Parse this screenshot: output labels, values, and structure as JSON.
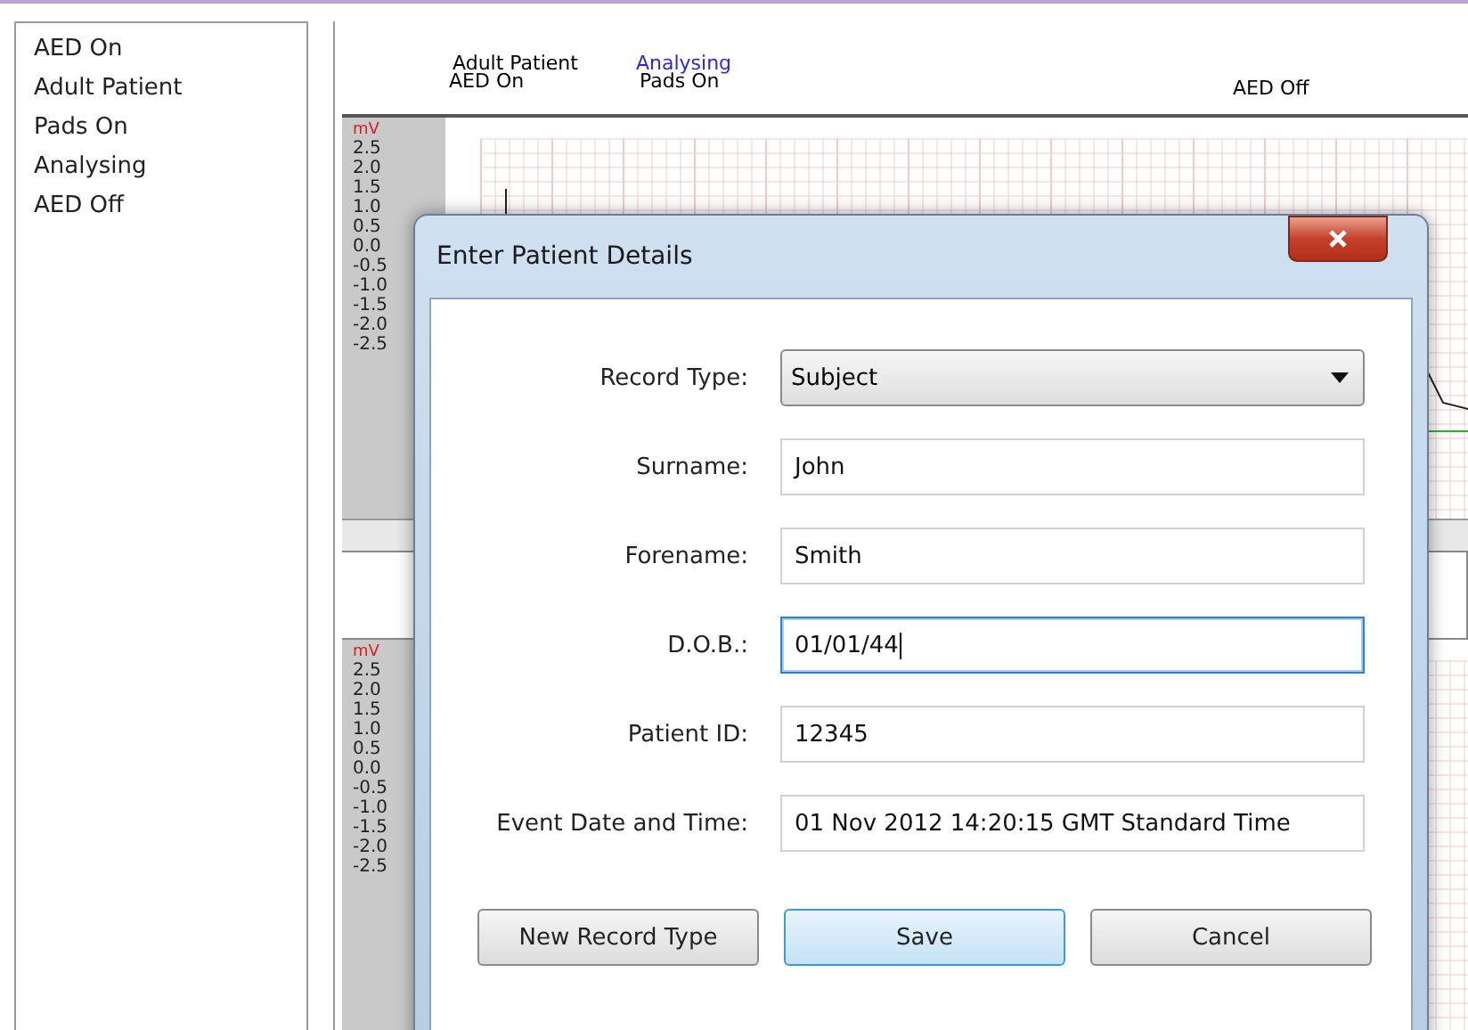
{
  "event_list": [
    "AED On",
    "Adult Patient",
    "Pads On",
    "Analysing",
    "AED Off"
  ],
  "top_chart": {
    "events": [
      {
        "label": "Adult Patient",
        "color": "#000000"
      },
      {
        "label": "AED On",
        "color": "#000000"
      },
      {
        "label": "Analysing",
        "color": "#2a2ad8"
      },
      {
        "label": "Pads On",
        "color": "#000000"
      },
      {
        "label": "AED Off",
        "color": "#000000"
      }
    ],
    "unit": "mV",
    "ticks": [
      "2.5",
      "2.0",
      "1.5",
      "1.0",
      "0.5",
      "0.0",
      "-0.5",
      "-1.0",
      "-1.5",
      "-2.0",
      "-2.5"
    ]
  },
  "bottom_chart": {
    "unit": "mV",
    "ticks": [
      "2.5",
      "2.0",
      "1.5",
      "1.0",
      "0.5",
      "0.0",
      "-0.5",
      "-1.0",
      "-1.5",
      "-2.0",
      "-2.5"
    ]
  },
  "dialog": {
    "title": "Enter Patient Details",
    "fields": [
      {
        "kind": "select",
        "label": "Record Type:",
        "value": "Subject"
      },
      {
        "kind": "text",
        "label": "Surname:",
        "value": "John",
        "focused": false
      },
      {
        "kind": "text",
        "label": "Forename:",
        "value": "Smith",
        "focused": false
      },
      {
        "kind": "text",
        "label": "D.O.B.:",
        "value": "01/01/44",
        "focused": true
      },
      {
        "kind": "text",
        "label": "Patient ID:",
        "value": "12345",
        "focused": false
      },
      {
        "kind": "text",
        "label": "Event Date and Time:",
        "value": "01 Nov 2012 14:20:15 GMT Standard Time",
        "focused": false
      }
    ],
    "buttons": [
      {
        "label": "New Record Type",
        "default": false
      },
      {
        "label": "Save",
        "default": true
      },
      {
        "label": "Cancel",
        "default": false
      }
    ]
  }
}
